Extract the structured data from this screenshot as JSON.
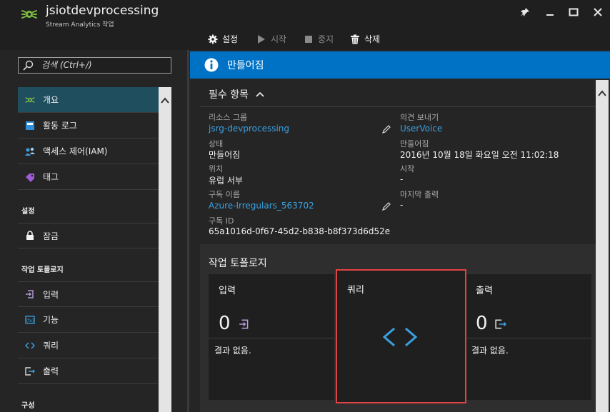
{
  "window": {
    "title": "jsiotdevprocessing",
    "subtitle": "Stream Analytics 작업"
  },
  "commands": [
    {
      "label": "설정",
      "icon": "gear-icon",
      "enabled": true
    },
    {
      "label": "시작",
      "icon": "play-icon",
      "enabled": false
    },
    {
      "label": "중지",
      "icon": "stop-icon",
      "enabled": false
    },
    {
      "label": "삭제",
      "icon": "trash-icon",
      "enabled": true
    }
  ],
  "sidebar": {
    "search_placeholder": "검색 (Ctrl+/)",
    "items": [
      {
        "label": "개요",
        "icon": "stream-analytics-icon"
      },
      {
        "label": "활동 로그",
        "icon": "activity-log-icon"
      },
      {
        "label": "액세스 제어(IAM)",
        "icon": "iam-icon"
      },
      {
        "label": "태그",
        "icon": "tag-icon"
      }
    ],
    "section_settings": "설정",
    "settings_items": [
      {
        "label": "잠금",
        "icon": "lock-icon"
      }
    ],
    "section_topology": "작업 토폴로지",
    "topology_items": [
      {
        "label": "입력",
        "icon": "input-icon"
      },
      {
        "label": "기능",
        "icon": "function-icon"
      },
      {
        "label": "쿼리",
        "icon": "query-icon"
      },
      {
        "label": "출력",
        "icon": "output-icon"
      }
    ],
    "section_config": "구성"
  },
  "blade": {
    "status_banner": "만들어짐",
    "essentials_title": "필수 항목",
    "left_fields": {
      "resource_group_label": "리소스 그룹",
      "resource_group_value": "jsrg-devprocessing",
      "status_label": "상태",
      "status_value": "만들어짐",
      "location_label": "위치",
      "location_value": "유럽 서부",
      "subscription_label": "구독 이름",
      "subscription_value": "Azure-Irregulars_563702",
      "subscription_id_label": "구독 ID",
      "subscription_id_value": "65a1016d-0f67-45d2-b838-b8f373d6d52e"
    },
    "right_fields": {
      "feedback_label": "의견 보내기",
      "feedback_value": "UserVoice",
      "created_label": "만들어짐",
      "created_value": "2016년 10월 18일 화요일 오전 11:02:18",
      "start_label": "시작",
      "start_value": "-",
      "last_output_label": "마지막 출력",
      "last_output_value": "-"
    },
    "topology": {
      "title": "작업 토폴로지",
      "inputs": {
        "title": "입력",
        "count": "0",
        "empty_text": "결과 없음."
      },
      "query": {
        "title": "쿼리"
      },
      "outputs": {
        "title": "출력",
        "count": "0",
        "empty_text": "결과 없음."
      }
    }
  },
  "colors": {
    "accent_blue": "#0072c6",
    "link": "#3aa0e0",
    "active_nav": "#1f4e5f",
    "highlight_border": "#e04343"
  }
}
